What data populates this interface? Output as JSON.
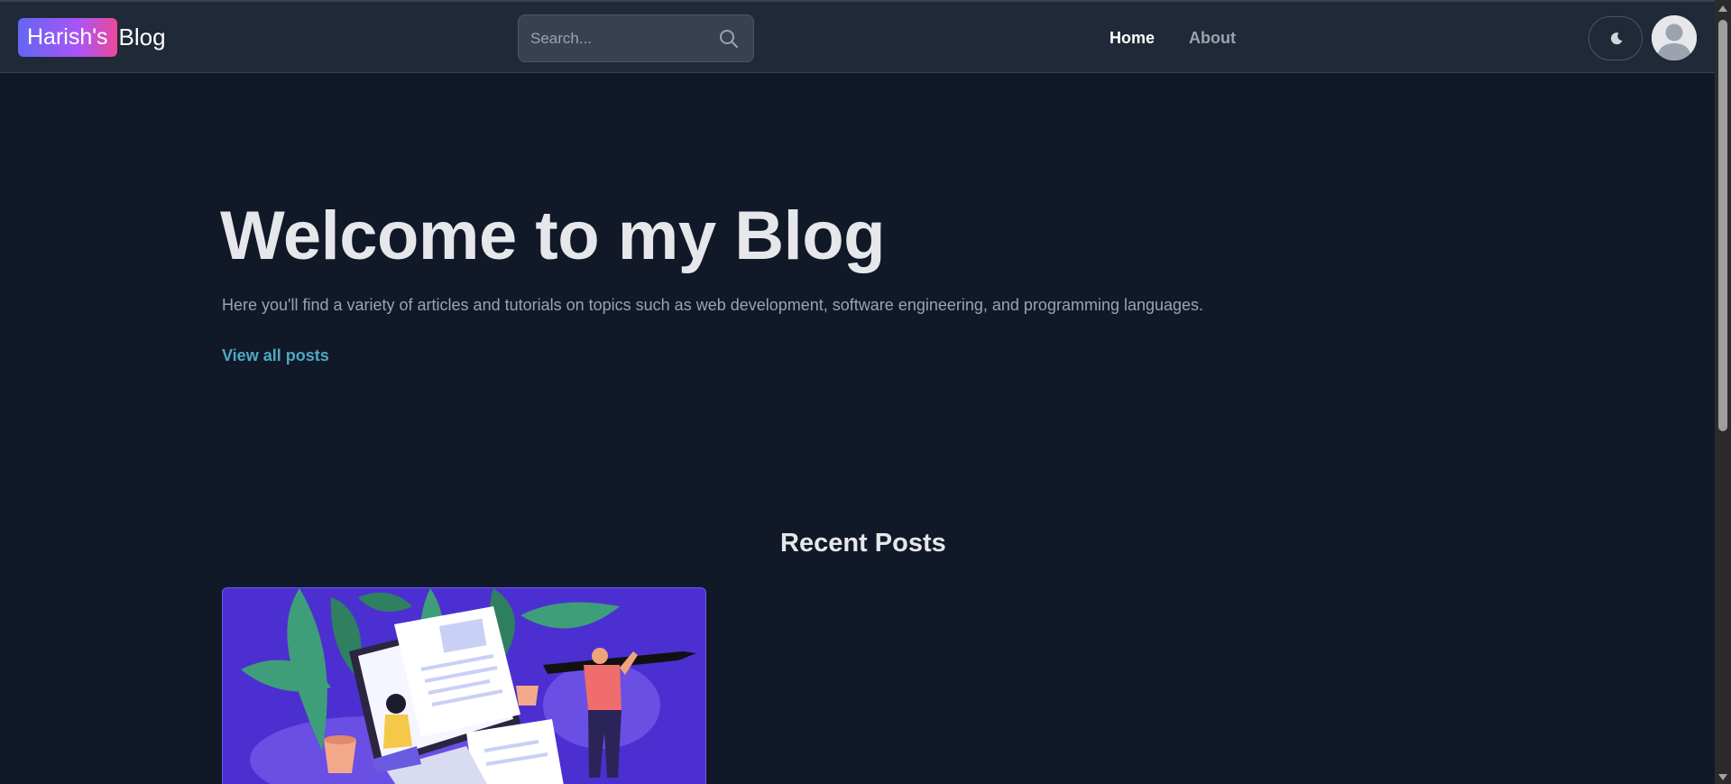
{
  "header": {
    "logo_badge": "Harish's",
    "logo_text": "Blog",
    "search_placeholder": "Search...",
    "nav": [
      {
        "label": "Home",
        "active": true
      },
      {
        "label": "About",
        "active": false
      }
    ]
  },
  "hero": {
    "title": "Welcome to my Blog",
    "subtitle": "Here you'll find a variety of articles and tutorials on topics such as web development, software engineering, and programming languages.",
    "link_label": "View all posts"
  },
  "recent": {
    "title": "Recent Posts"
  },
  "icons": {
    "search": "search-icon",
    "theme": "moon-icon",
    "avatar": "user-avatar-icon"
  },
  "colors": {
    "background": "#111827",
    "navbar": "#1f2937",
    "link_accent": "#4fa7c4",
    "logo_gradient_start": "#6366f1",
    "logo_gradient_end": "#ec4899",
    "card_bg": "#4c2fd1"
  }
}
